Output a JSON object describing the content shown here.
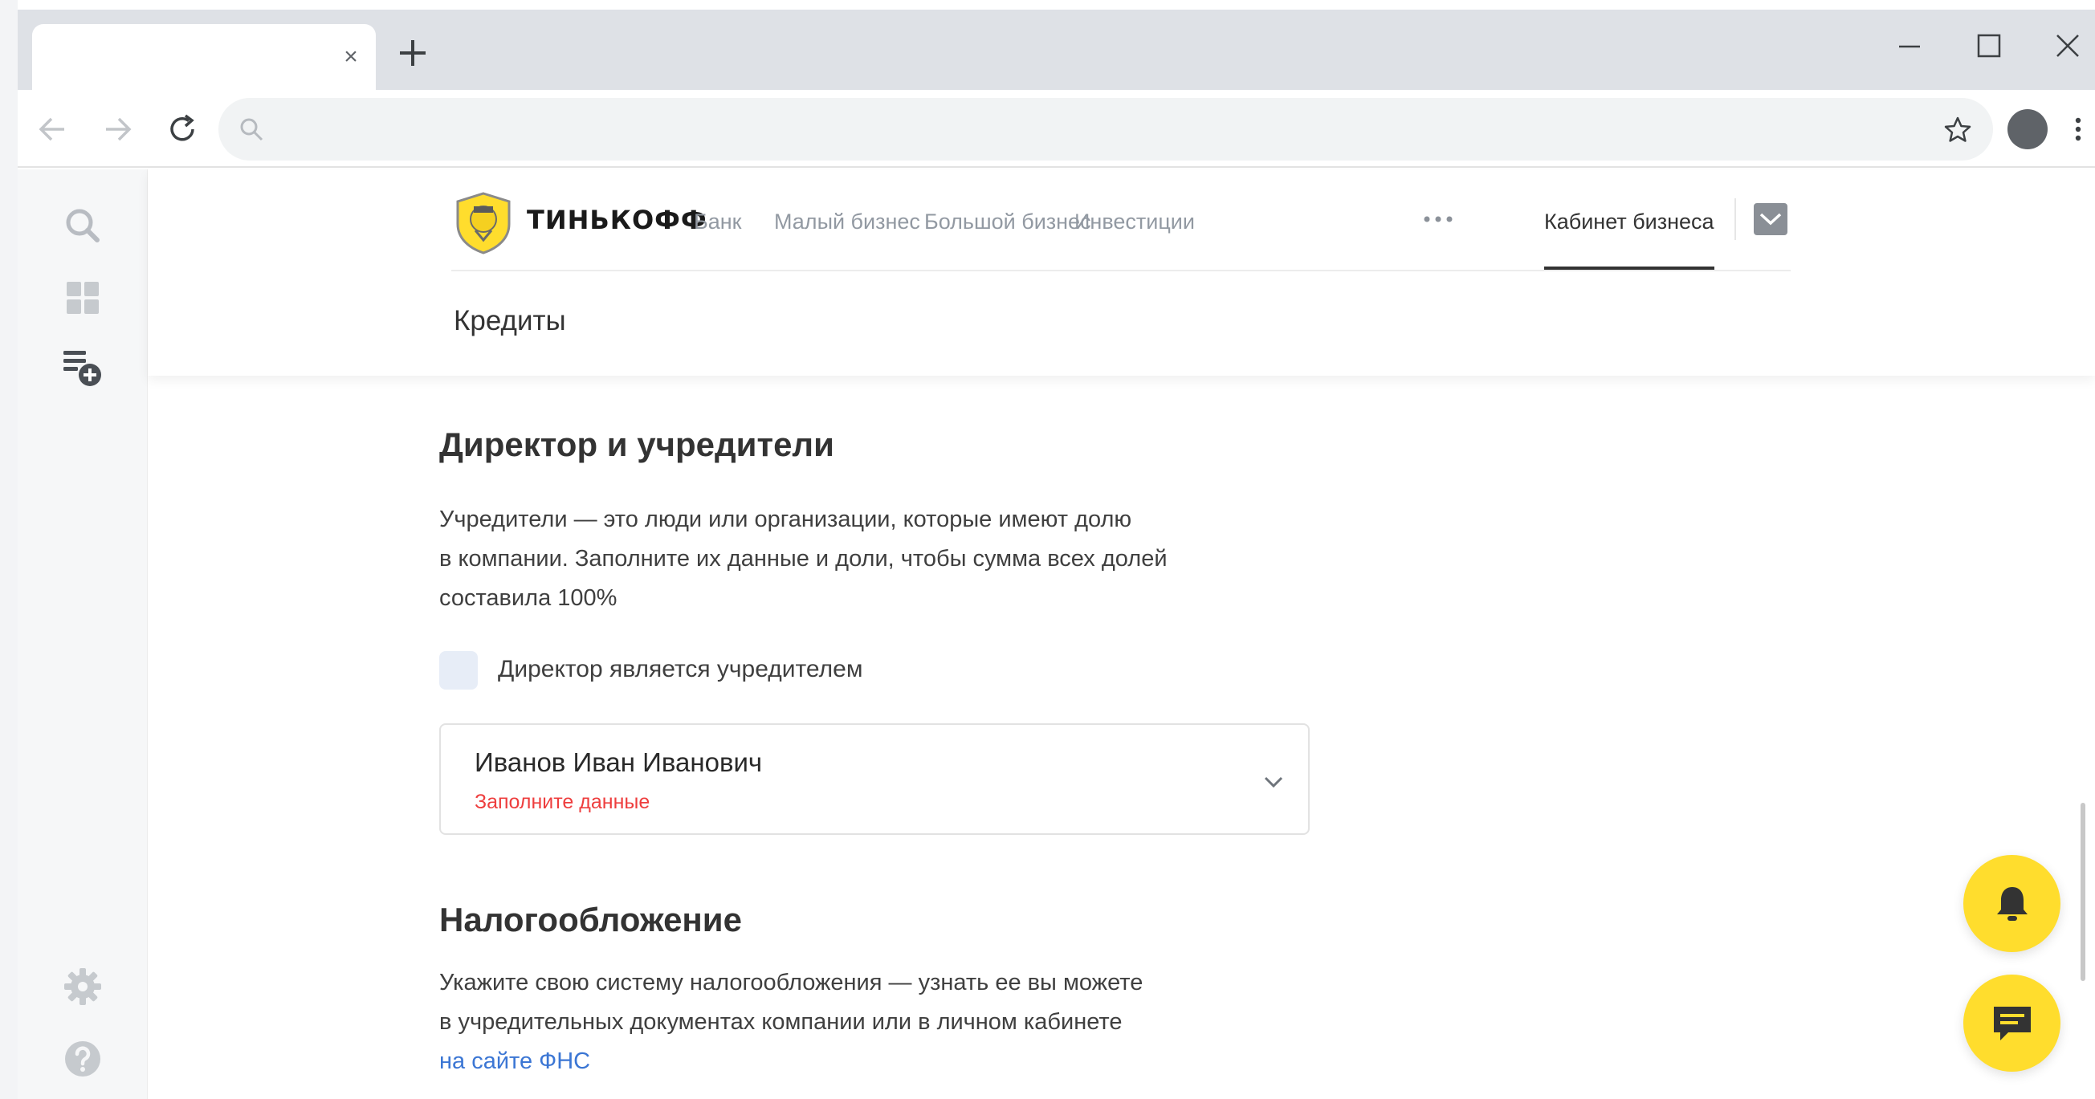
{
  "browser": {
    "tab_title": "",
    "address": ""
  },
  "header": {
    "brand": "ТИНЬКОФФ",
    "nav": [
      "Банк",
      "Малый бизнес",
      "Большой бизнес",
      "Инвестиции"
    ],
    "cabinet": "Кабинет бизнеса",
    "breadcrumb": "Кредиты"
  },
  "founders": {
    "title": "Директор и учредители",
    "description_lines": [
      "Учредители — это люди или организации, которые имеют долю",
      "в компании. Заполните их данные и доли, чтобы сумма всех долей",
      "составила 100%"
    ],
    "checkbox_label": "Директор является учредителем",
    "person_name": "Иванов Иван Иванович",
    "person_error": "Заполните данные"
  },
  "taxation": {
    "title": "Налогообложение",
    "description_lines": [
      "Укажите свою систему налогообложения — узнать ее вы можете",
      "в учредительных документах компании или в личном кабинете"
    ],
    "link_text": "на сайте ФНС"
  },
  "colors": {
    "accent": "#ffdd2d",
    "error": "#ee3e3e",
    "link": "#3b76d4",
    "text": "#333333"
  },
  "icons": {
    "sidebar_top": [
      "search-icon",
      "dashboard-icon",
      "add-list-icon"
    ],
    "sidebar_bottom": [
      "settings-icon",
      "help-icon"
    ],
    "fabs": [
      "bell-icon",
      "chat-icon"
    ]
  }
}
